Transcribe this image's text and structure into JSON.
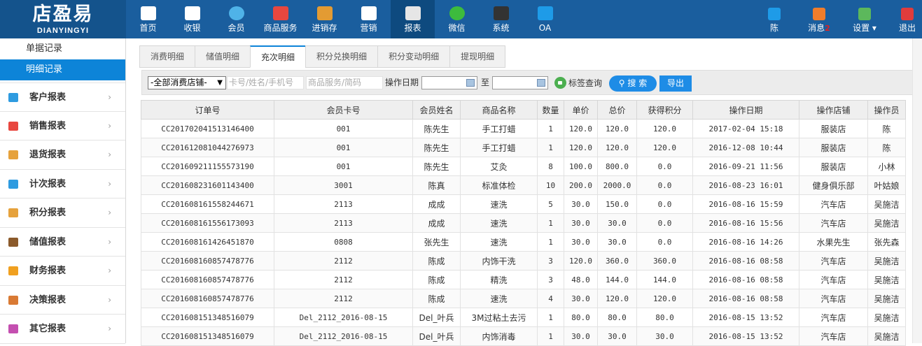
{
  "logo": {
    "cn": "店盈易",
    "en": "DIANYINGYI"
  },
  "nav": [
    {
      "label": "首页",
      "icon": "home-icon",
      "color": "#ffffff"
    },
    {
      "label": "收银",
      "icon": "cash-register-icon",
      "color": "#ffffff"
    },
    {
      "label": "会员",
      "icon": "member-icon",
      "color": "#4fb3e8"
    },
    {
      "label": "商品服务",
      "icon": "goods-service-icon",
      "color": "#e8473f"
    },
    {
      "label": "进销存",
      "icon": "inventory-icon",
      "color": "#e39b33"
    },
    {
      "label": "营销",
      "icon": "megaphone-icon",
      "color": "#ffffff"
    },
    {
      "label": "报表",
      "icon": "report-icon",
      "color": "#e6e6e6"
    },
    {
      "label": "微信",
      "icon": "wechat-icon",
      "color": "#3dbb3d"
    },
    {
      "label": "系统",
      "icon": "monitor-icon",
      "color": "#333333"
    },
    {
      "label": "OA",
      "icon": "oa-icon",
      "color": "#1e9be8"
    }
  ],
  "right_nav": {
    "user": {
      "label": "陈",
      "icon": "user-icon",
      "color": "#1e9be8"
    },
    "messages": {
      "label": "消息",
      "badge": "2",
      "icon": "bell-icon",
      "color": "#f07d2b"
    },
    "settings": {
      "label": "设置",
      "icon": "gear-icon",
      "color": "#5cb85c"
    },
    "logout": {
      "label": "退出",
      "icon": "logout-icon",
      "color": "#e03c3c"
    }
  },
  "sidebar": {
    "sub_items": [
      "单据记录",
      "明细记录"
    ],
    "menu": [
      {
        "label": "客户报表",
        "icon": "customer-icon",
        "color": "#2e9be0"
      },
      {
        "label": "销售报表",
        "icon": "sales-icon",
        "color": "#e8473f"
      },
      {
        "label": "退货报表",
        "icon": "return-icon",
        "color": "#e6a23c"
      },
      {
        "label": "计次报表",
        "icon": "bar-chart-icon",
        "color": "#2e9be0"
      },
      {
        "label": "积分报表",
        "icon": "points-tag-icon",
        "color": "#e6a23c"
      },
      {
        "label": "储值报表",
        "icon": "wallet-icon",
        "color": "#8b5a2b"
      },
      {
        "label": "财务报表",
        "icon": "coin-icon",
        "color": "#f0a020"
      },
      {
        "label": "决策报表",
        "icon": "decision-icon",
        "color": "#d97a34"
      },
      {
        "label": "其它报表",
        "icon": "folder-icon",
        "color": "#c44fb0"
      }
    ]
  },
  "tabs": [
    "消费明细",
    "储值明细",
    "充次明细",
    "积分兑换明细",
    "积分变动明细",
    "提现明细"
  ],
  "filter": {
    "store_select": "-全部消费店铺-",
    "card_placeholder": "卡号/姓名/手机号",
    "goods_placeholder": "商品服务/简码",
    "date_label": "操作日期",
    "to_label": "至",
    "tag_query": "标签查询",
    "search_button": "搜 索",
    "export_button": "导出"
  },
  "table": {
    "headers": [
      "订单号",
      "会员卡号",
      "会员姓名",
      "商品名称",
      "数量",
      "单价",
      "总价",
      "获得积分",
      "操作日期",
      "操作店铺",
      "操作员"
    ],
    "rows": [
      [
        "CC201702041513146400",
        "001",
        "陈先生",
        "手工打蜡",
        "1",
        "120.0",
        "120.0",
        "120.0",
        "2017-02-04 15:18",
        "服装店",
        "陈"
      ],
      [
        "CC201612081044276973",
        "001",
        "陈先生",
        "手工打蜡",
        "1",
        "120.0",
        "120.0",
        "120.0",
        "2016-12-08 10:44",
        "服装店",
        "陈"
      ],
      [
        "CC201609211155573190",
        "001",
        "陈先生",
        "艾灸",
        "8",
        "100.0",
        "800.0",
        "0.0",
        "2016-09-21 11:56",
        "服装店",
        "小林"
      ],
      [
        "CC201608231601143400",
        "3001",
        "陈真",
        "标准体检",
        "10",
        "200.0",
        "2000.0",
        "0.0",
        "2016-08-23 16:01",
        "健身俱乐部",
        "叶姑娘"
      ],
      [
        "CC201608161558244671",
        "2113",
        "成成",
        "速洗",
        "5",
        "30.0",
        "150.0",
        "0.0",
        "2016-08-16 15:59",
        "汽车店",
        "吴施洁"
      ],
      [
        "CC201608161556173093",
        "2113",
        "成成",
        "速洗",
        "1",
        "30.0",
        "30.0",
        "0.0",
        "2016-08-16 15:56",
        "汽车店",
        "吴施洁"
      ],
      [
        "CC201608161426451870",
        "0808",
        "张先生",
        "速洗",
        "1",
        "30.0",
        "30.0",
        "0.0",
        "2016-08-16 14:26",
        "水果先生",
        "张先森"
      ],
      [
        "CC201608160857478776",
        "2112",
        "陈成",
        "内饰干洗",
        "3",
        "120.0",
        "360.0",
        "360.0",
        "2016-08-16 08:58",
        "汽车店",
        "吴施洁"
      ],
      [
        "CC201608160857478776",
        "2112",
        "陈成",
        "精洗",
        "3",
        "48.0",
        "144.0",
        "144.0",
        "2016-08-16 08:58",
        "汽车店",
        "吴施洁"
      ],
      [
        "CC201608160857478776",
        "2112",
        "陈成",
        "速洗",
        "4",
        "30.0",
        "120.0",
        "120.0",
        "2016-08-16 08:58",
        "汽车店",
        "吴施洁"
      ],
      [
        "CC201608151348516079",
        "Del_2112_2016-08-15",
        "Del_叶兵",
        "3M过粘土去污",
        "1",
        "80.0",
        "80.0",
        "80.0",
        "2016-08-15 13:52",
        "汽车店",
        "吴施洁"
      ],
      [
        "CC201608151348516079",
        "Del_2112_2016-08-15",
        "Del_叶兵",
        "内饰消毒",
        "1",
        "30.0",
        "30.0",
        "30.0",
        "2016-08-15 13:52",
        "汽车店",
        "吴施洁"
      ]
    ]
  }
}
